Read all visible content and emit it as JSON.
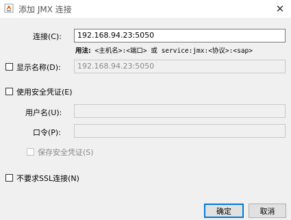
{
  "window": {
    "title": "添加 JMX 连接",
    "close_glyph": "✕"
  },
  "connection": {
    "label": "连接(C):",
    "value": "192.168.94.23:5050",
    "usage_bold": "用法:",
    "usage_text": "<主机名>:<端口> 或 service:jmx:<协议>:<sap>"
  },
  "display_name": {
    "label": "显示名称(D):",
    "checked": false,
    "value": "192.168.94.23:5050"
  },
  "security": {
    "label": "使用安全凭证(E)",
    "checked": false,
    "username_label": "用户名(U):",
    "username_value": "",
    "password_label": "口令(P):",
    "password_value": "",
    "save_label": "保存安全凭证(S)",
    "save_checked": false
  },
  "no_ssl": {
    "label": "不要求SSL连接(N)",
    "checked": false
  },
  "buttons": {
    "ok": "确定",
    "cancel": "取消"
  },
  "colors": {
    "accent": "#0078d7",
    "disabled_text": "#8a8a8a"
  },
  "icons": {
    "app": "java-coffee-cup-icon",
    "close": "close-icon"
  }
}
